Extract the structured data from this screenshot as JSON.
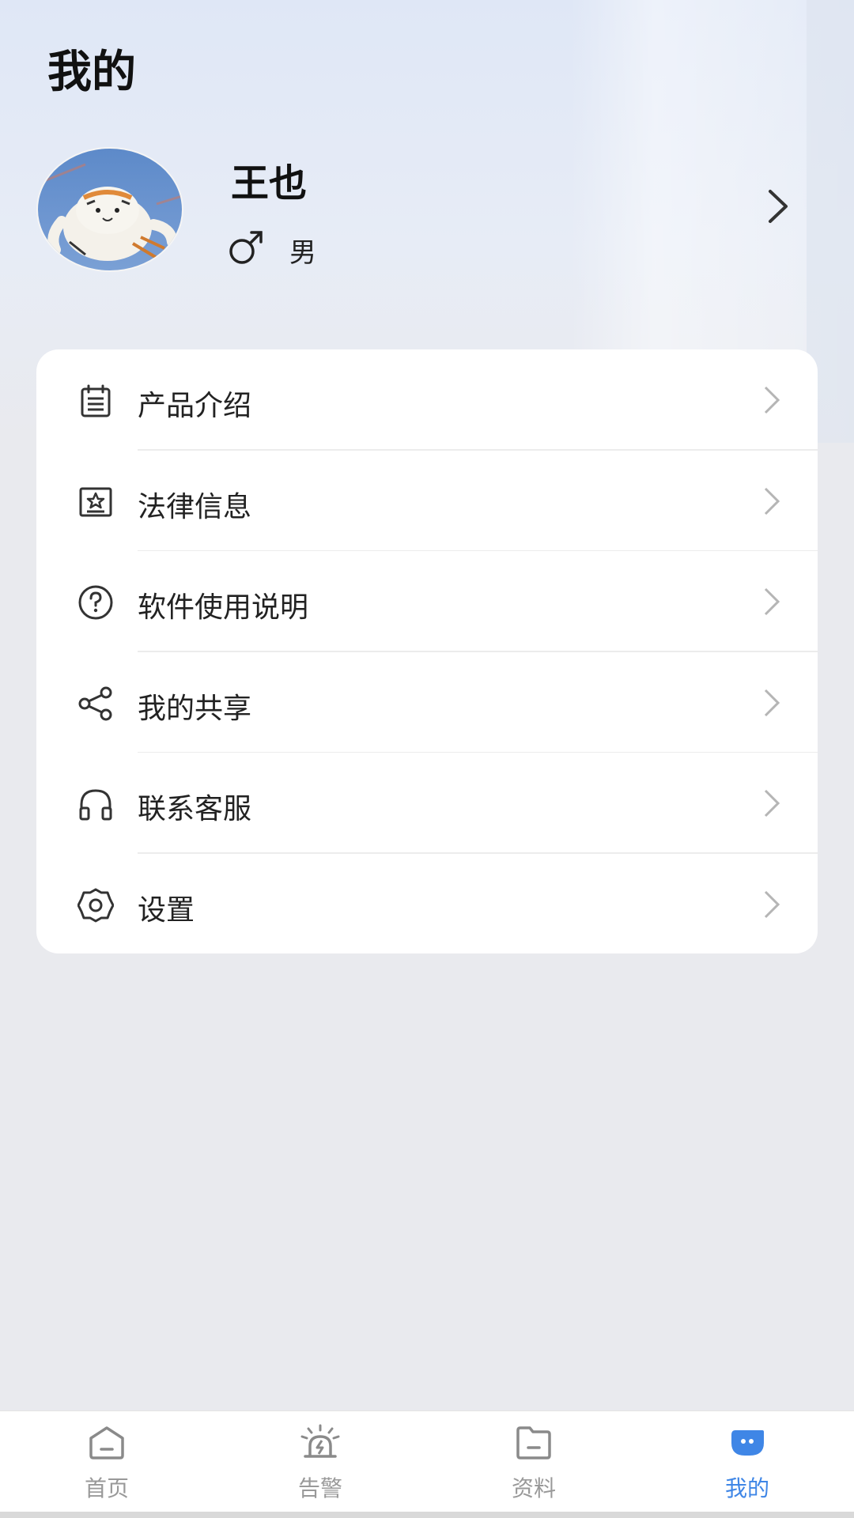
{
  "page": {
    "title": "我的"
  },
  "profile": {
    "name": "王也",
    "gender": "男"
  },
  "menu": [
    {
      "label": "产品介绍",
      "icon": "clipboard-icon"
    },
    {
      "label": "法律信息",
      "icon": "certificate-icon"
    },
    {
      "label": "软件使用说明",
      "icon": "help-circle-icon"
    },
    {
      "label": "我的共享",
      "icon": "share-icon"
    },
    {
      "label": "联系客服",
      "icon": "headset-icon"
    },
    {
      "label": "设置",
      "icon": "gear-icon"
    }
  ],
  "tabs": [
    {
      "label": "首页",
      "icon": "home-icon",
      "active": false
    },
    {
      "label": "告警",
      "icon": "alarm-icon",
      "active": false
    },
    {
      "label": "资料",
      "icon": "folder-icon",
      "active": false
    },
    {
      "label": "我的",
      "icon": "profile-chat-icon",
      "active": true
    }
  ],
  "colors": {
    "accent": "#3f86e6",
    "inactive_tab": "#999999",
    "card": "#ffffff",
    "background": "#e9eaee"
  }
}
